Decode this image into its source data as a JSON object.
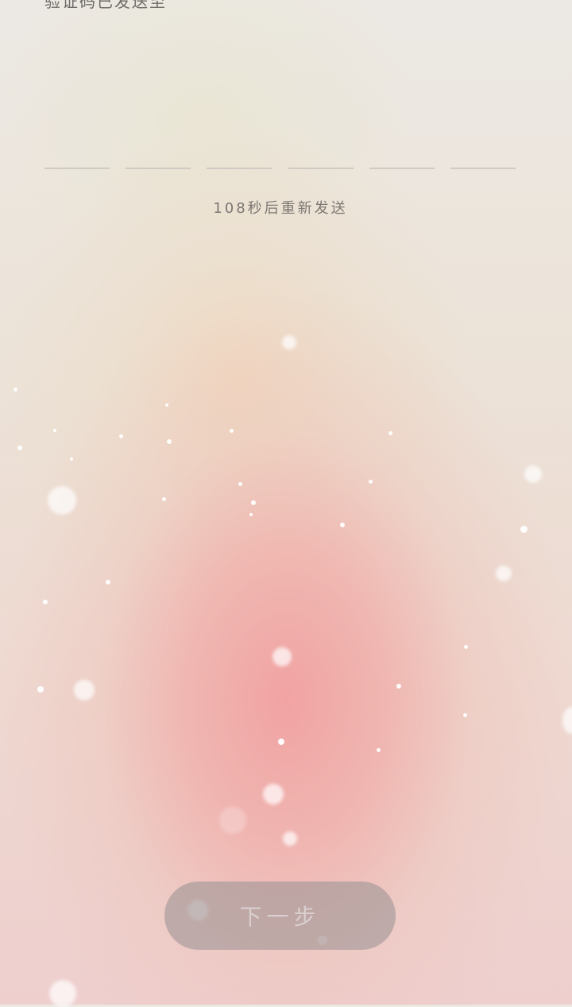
{
  "header": {
    "title_fragment": "验证码已发送至"
  },
  "otp": {
    "digit_count": 6
  },
  "resend": {
    "label": "108秒后重新发送"
  },
  "actions": {
    "next_label": "下一步"
  },
  "colors": {
    "accent_pink": "#f1a0a0",
    "button_gray": "#a09696",
    "text_gray": "#7c7772"
  }
}
